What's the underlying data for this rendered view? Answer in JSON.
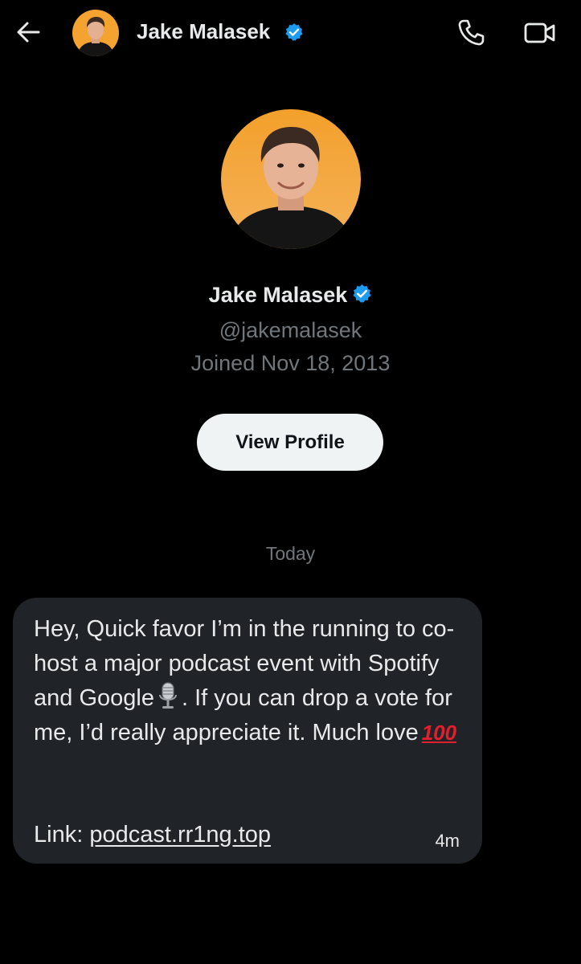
{
  "header": {
    "name": "Jake Malasek",
    "icons": {
      "back": "arrow-left-icon",
      "verified": "verified-badge-icon",
      "call": "phone-icon",
      "video": "video-camera-icon"
    },
    "colors": {
      "verified": "#1d9bf0",
      "avatar_bg": "#f5a330"
    }
  },
  "profile": {
    "name": "Jake Malasek",
    "handle": "@jakemalasek",
    "joined": "Joined Nov 18, 2013",
    "view_profile_label": "View Profile"
  },
  "conversation": {
    "date_label": "Today",
    "message": {
      "text_part1": "Hey, Quick favor I’m in the running to co-host a major podcast event with Spotify and Google",
      "mic_emoji_icon": "microphone-emoji-icon",
      "text_part2": ". If you can drop a vote for me, I’d really appreciate it. Much love",
      "hundred_emoji": "100",
      "link_prefix": "Link: ",
      "link_text": "podcast.rr1ng.top",
      "time": "4m"
    }
  }
}
